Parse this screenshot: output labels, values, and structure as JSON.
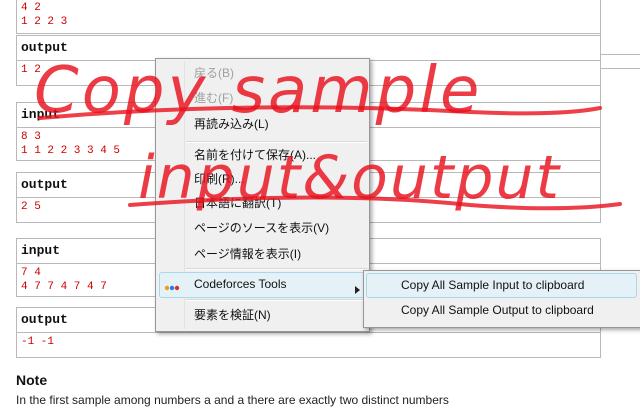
{
  "samples": [
    {
      "input_header": "",
      "input_lines": [
        "4 2",
        "1 2 2 3"
      ],
      "output_header": "output",
      "output_lines": [
        "1 2"
      ]
    },
    {
      "input_header": "input",
      "input_lines": [
        "8 3",
        "1 1 2 2 3 3 4 5"
      ],
      "output_header": "output",
      "output_lines": [
        "2 5"
      ]
    },
    {
      "input_header": "input",
      "input_lines": [
        "7 4",
        "4 7 7 4 7 4 7"
      ],
      "output_header": "output",
      "output_lines": [
        "-1 -1"
      ]
    }
  ],
  "note": {
    "title": "Note",
    "text": "In the first sample among numbers a and a there are exactly two distinct numbers"
  },
  "context_menu": {
    "back": "戻る(B)",
    "forward": "進む(F)",
    "reload": "再読み込み(L)",
    "save_as": "名前を付けて保存(A)...",
    "print": "印刷(R)...",
    "translate": "日本語に翻訳(T)",
    "view_source": "ページのソースを表示(V)",
    "page_info": "ページ情報を表示(I)",
    "extension": "Codeforces Tools",
    "inspect": "要素を検証(N)"
  },
  "submenu": {
    "copy_input": "Copy All Sample Input to clipboard",
    "copy_output": "Copy All Sample Output to clipboard"
  },
  "overlay_text": {
    "line1": "Copy sample",
    "line2": "input&output"
  },
  "colors": {
    "sample_text": "#cc0000",
    "overlay_text": "#e8101c",
    "highlight": "#e4f2f8"
  }
}
